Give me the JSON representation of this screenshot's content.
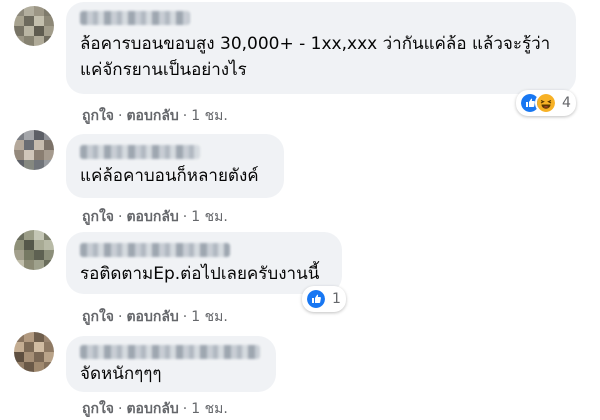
{
  "comments": [
    {
      "text": "ล้อคารบอนขอบสูง 30,000+ - 1xx,xxx ว่ากันแค่ล้อ แล้วจะรู้ว่า\nแค่จักรยานเป็นอย่างไร",
      "like": "ถูกใจ",
      "reply": "ตอบกลับ",
      "time": "1 ชม.",
      "reactions": [
        "like-icon",
        "haha-icon"
      ],
      "reaction_count": "4"
    },
    {
      "text": "แค่ล้อคาบอนก็หลายตังค์",
      "like": "ถูกใจ",
      "reply": "ตอบกลับ",
      "time": "1 ชม."
    },
    {
      "text": "รอติดตามEp.ต่อไปเลยครับงานนี้",
      "like": "ถูกใจ",
      "reply": "ตอบกลับ",
      "time": "1 ชม.",
      "reactions": [
        "like-icon"
      ],
      "reaction_count": "1"
    },
    {
      "text": "จัดหนักๆๆๆ",
      "like": "ถูกใจ",
      "reply": "ตอบกลับ",
      "time": "1 ชม."
    }
  ],
  "colors": {
    "bubble": "#f0f2f5",
    "like_blue": "#1877f2",
    "muted_text": "#65676b"
  }
}
